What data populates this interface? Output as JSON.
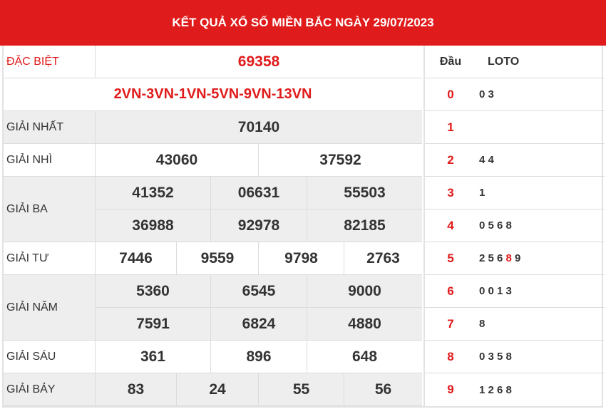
{
  "header": {
    "title": "KẾT QUẢ XỔ SỐ MIỀN BẮC NGÀY 29/07/2023"
  },
  "prizes": {
    "special": {
      "label": "ĐẶC BIỆT",
      "value": "69358",
      "codes": "2VN-3VN-1VN-5VN-9VN-13VN"
    },
    "first": {
      "label": "GIẢI NHẤT",
      "values": [
        "70140"
      ]
    },
    "second": {
      "label": "GIẢI NHÌ",
      "values": [
        "43060",
        "37592"
      ]
    },
    "third": {
      "label": "GIẢI BA",
      "values": [
        "41352",
        "06631",
        "55503",
        "36988",
        "92978",
        "82185"
      ]
    },
    "fourth": {
      "label": "GIẢI TƯ",
      "values": [
        "7446",
        "9559",
        "9798",
        "2763"
      ]
    },
    "fifth": {
      "label": "GIẢI NĂM",
      "values": [
        "5360",
        "6545",
        "9000",
        "7591",
        "6824",
        "4880"
      ]
    },
    "sixth": {
      "label": "GIẢI SÁU",
      "values": [
        "361",
        "896",
        "648"
      ]
    },
    "seventh": {
      "label": "GIẢI BẢY",
      "values": [
        "83",
        "24",
        "55",
        "56"
      ]
    }
  },
  "loto": {
    "head_label": "Đầu",
    "loto_label": "LOTO",
    "rows": [
      {
        "dau": "0",
        "nums": "0 3"
      },
      {
        "dau": "1",
        "nums": ""
      },
      {
        "dau": "2",
        "nums": "4 4"
      },
      {
        "dau": "3",
        "nums": "1"
      },
      {
        "dau": "4",
        "nums": "0 5 6 8"
      },
      {
        "dau": "5",
        "nums_before": "2 5 6 ",
        "nums_highlight": "8",
        "nums_after": " 9"
      },
      {
        "dau": "6",
        "nums": "0 0 1 3"
      },
      {
        "dau": "7",
        "nums": "8"
      },
      {
        "dau": "8",
        "nums": "0 3 5 8"
      },
      {
        "dau": "9",
        "nums": "1 2 6 8"
      }
    ]
  },
  "colors": {
    "accent": "#e01b1b",
    "stripe": "#eeeeee",
    "border": "#dcdcdc"
  }
}
